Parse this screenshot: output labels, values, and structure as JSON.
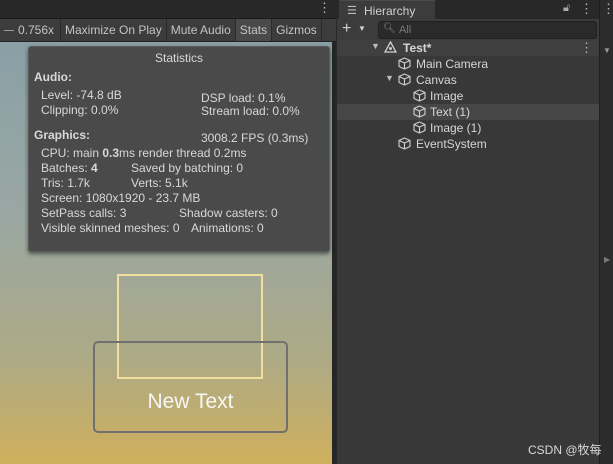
{
  "game_toolbar": {
    "scale_value": "0.756x",
    "maximize_on_play": "Maximize On Play",
    "mute_audio": "Mute Audio",
    "stats": "Stats",
    "gizmos": "Gizmos"
  },
  "statistics": {
    "title": "Statistics",
    "audio_header": "Audio:",
    "level": "Level: -74.8 dB",
    "dsp_load": "DSP load: 0.1%",
    "clipping": "Clipping: 0.0%",
    "stream_load": "Stream load: 0.0%",
    "graphics_header": "Graphics:",
    "fps": "3008.2 FPS (0.3ms)",
    "cpu_prefix": "CPU: main ",
    "cpu_main": "0.3",
    "cpu_suffix": "ms  render thread 0.2ms",
    "batches_prefix": "Batches: ",
    "batches_value": "4",
    "saved_by_batching": "Saved by batching: 0",
    "tris": "Tris: 1.7k",
    "verts": "Verts: 5.1k",
    "screen": "Screen: 1080x1920 - 23.7 MB",
    "setpass_calls": "SetPass calls: 3",
    "shadow_casters": "Shadow casters: 0",
    "visible_skinned_meshes": "Visible skinned meshes: 0",
    "animations": "Animations: 0"
  },
  "game_view": {
    "text_content": "New Text"
  },
  "hierarchy": {
    "tab_label": "Hierarchy",
    "search_placeholder": "All",
    "scene_name": "Test*",
    "items": [
      {
        "label": "Main Camera"
      },
      {
        "label": "Canvas"
      },
      {
        "label": "Image"
      },
      {
        "label": "Text (1)"
      },
      {
        "label": "Image (1)"
      },
      {
        "label": "EventSystem"
      }
    ]
  },
  "watermark": "CSDN @牧每",
  "colors": {
    "panel_bg": "#383838",
    "selection_bg": "#474747",
    "image_outline": "#f0df9e"
  },
  "icons": [
    "kebab-menu-icon",
    "hierarchy-icon",
    "lock-icon",
    "add-icon",
    "search-icon",
    "unity-scene-icon",
    "gameobject-cube-icon",
    "expand-arrow-icon"
  ]
}
